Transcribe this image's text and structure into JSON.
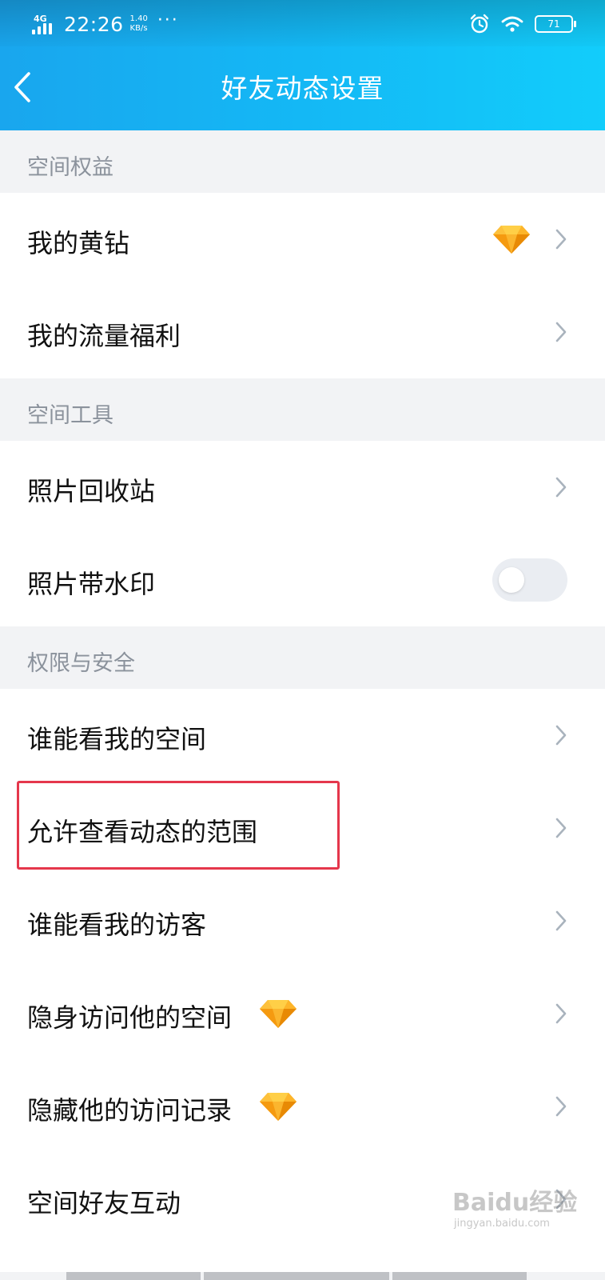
{
  "status_bar": {
    "network": "4G",
    "time": "22:26",
    "speed_value": "1.40",
    "speed_unit": "KB/s",
    "more": "···",
    "battery": "71"
  },
  "header": {
    "title": "好友动态设置"
  },
  "sections": [
    {
      "title": "空间权益"
    },
    {
      "title": "空间工具"
    },
    {
      "title": "权限与安全"
    }
  ],
  "rows": [
    {
      "label": "我的黄钻",
      "badge_icon": "diamond-icon"
    },
    {
      "label": "我的流量福利"
    },
    {
      "label": "照片回收站"
    },
    {
      "label": "照片带水印",
      "toggle_on": false
    },
    {
      "label": "谁能看我的空间"
    },
    {
      "label": "允许查看动态的范围",
      "highlighted": true
    },
    {
      "label": "谁能看我的访客"
    },
    {
      "label": "隐身访问他的空间",
      "badge_icon": "diamond-icon"
    },
    {
      "label": "隐藏他的访问记录",
      "badge_icon": "diamond-icon"
    },
    {
      "label": "空间好友互动"
    }
  ],
  "watermark": {
    "main": "Baidu经验",
    "sub": "jingyan.baidu.com"
  },
  "colors": {
    "header_gradient_start": "#19a6ee",
    "header_gradient_end": "#12cdfb",
    "highlight_border": "#e5374c",
    "diamond": "#f7a51c"
  }
}
